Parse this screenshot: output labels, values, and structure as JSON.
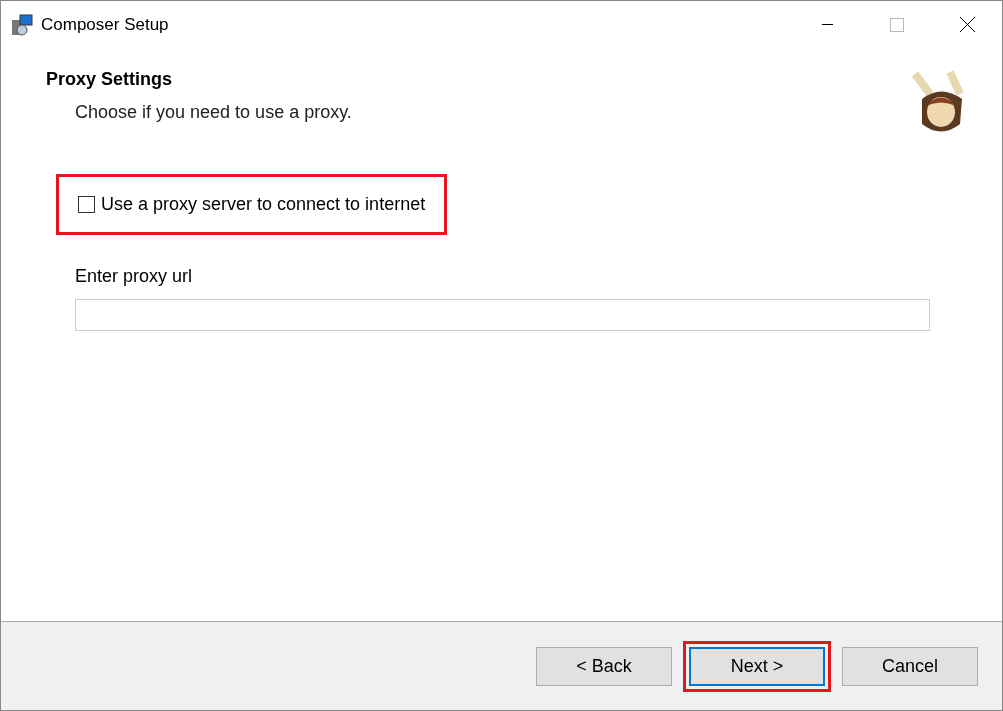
{
  "window": {
    "title": "Composer Setup"
  },
  "header": {
    "title": "Proxy Settings",
    "subtitle": "Choose if you need to use a proxy."
  },
  "proxy_checkbox": {
    "label": "Use a proxy server to connect to internet",
    "checked": false,
    "highlighted": true
  },
  "proxy_url": {
    "label": "Enter proxy url"
  },
  "buttons": [
    {
      "label": "< Back",
      "default": false,
      "highlighted": false
    },
    {
      "label": "Next >",
      "default": true,
      "highlighted": true
    },
    {
      "label": "Cancel",
      "default": false,
      "highlighted": false
    }
  ]
}
